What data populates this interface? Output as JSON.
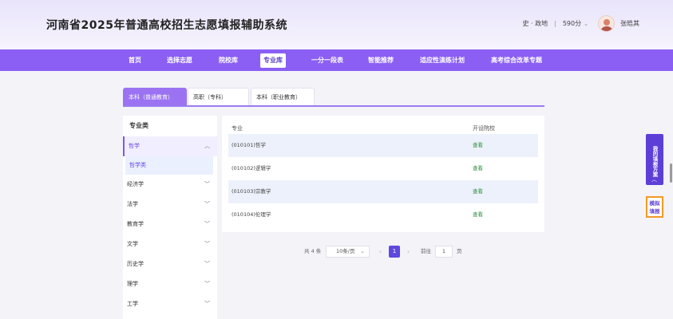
{
  "header": {
    "title": "河南省2025年普通高校招生志愿填报辅助系统",
    "subjects": "史 · 政地",
    "score": "590分",
    "username": "张皓其"
  },
  "nav": {
    "items": [
      "首页",
      "选择志愿",
      "院校库",
      "专业库",
      "一分一段表",
      "智能推荐",
      "适应性演练计划",
      "高考综合改革专题"
    ],
    "active": "专业库"
  },
  "tabs": [
    "本科（普通教育）",
    "高职（专科）",
    "本科（职业教育）"
  ],
  "sidebar": {
    "title": "专业类",
    "items": [
      "哲学",
      "经济学",
      "法学",
      "教育学",
      "文学",
      "历史学",
      "理学",
      "工学"
    ],
    "sub_item": "哲学类"
  },
  "table": {
    "headers": [
      "专业",
      "开设院校"
    ],
    "rows": [
      {
        "name": "(010101)哲学",
        "action": "查看"
      },
      {
        "name": "(010102)逻辑学",
        "action": "查看"
      },
      {
        "name": "(010103)宗教学",
        "action": "查看"
      },
      {
        "name": "(010104)伦理学",
        "action": "查看"
      }
    ]
  },
  "pagination": {
    "total": "共 4 条",
    "page_size": "10条/页",
    "current_page": "1",
    "goto_label": "前往",
    "goto_value": "1",
    "page_suffix": "页"
  },
  "float": {
    "plan_label": "我的填报方案",
    "simulate_label": "模拟填报"
  },
  "colors": {
    "nav_bg": "#8b5ff4",
    "accent": "#5d49e0",
    "link_green": "#2a8e3a",
    "float_border": "#f29a25"
  }
}
